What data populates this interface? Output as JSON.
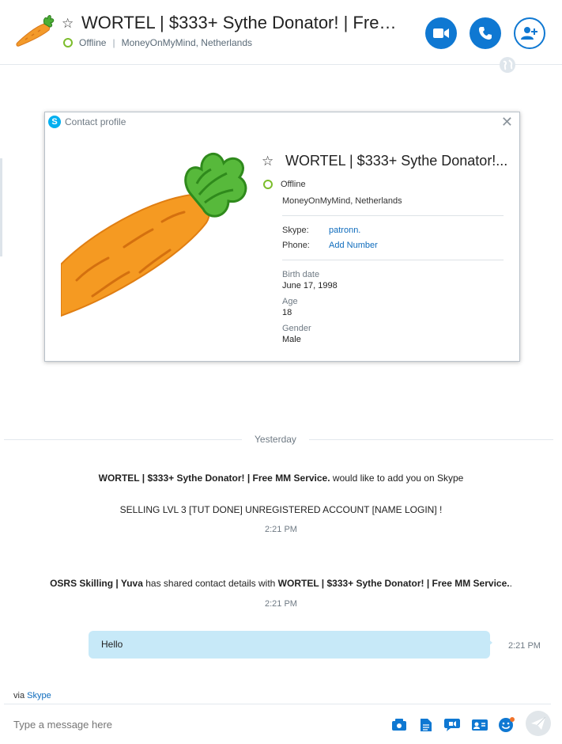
{
  "header": {
    "title": "WORTEL | $333+ Sythe Donator! | Free M...",
    "status": "Offline",
    "location": "MoneyOnMyMind, Netherlands",
    "separator": "|",
    "star_glyph": "☆"
  },
  "profile": {
    "window_title": "Contact profile",
    "skype_glyph": "S",
    "close_glyph": "✕",
    "name": "WORTEL | $333+ Sythe Donator!...",
    "status": "Offline",
    "location": "MoneyOnMyMind, Netherlands",
    "skype_label": "Skype:",
    "skype_value": "patronn.",
    "phone_label": "Phone:",
    "phone_value": "Add Number",
    "birth_label": "Birth date",
    "birth_value": "June 17, 1998",
    "age_label": "Age",
    "age_value": "18",
    "gender_label": "Gender",
    "gender_value": "Male"
  },
  "conversation": {
    "day_label": "Yesterday",
    "messages": [
      {
        "sender": "WORTEL | $333+ Sythe Donator! | Free MM Service.",
        "text": " would like to add you on Skype"
      },
      {
        "text": "SELLING LVL 3 [TUT DONE] UNREGISTERED ACCOUNT [NAME LOGIN] !"
      },
      {
        "time": "2:21 PM"
      },
      {
        "sender": "OSRS Skilling | Yuva",
        "text": " has shared contact details with ",
        "target": "WORTEL | $333+ Sythe Donator! | Free MM Service.",
        "suffix": "."
      },
      {
        "time": "2:21 PM"
      },
      {
        "text": "Hello",
        "time": "2:21 PM"
      }
    ]
  },
  "composer": {
    "via_prefix": "via ",
    "via_link": "Skype",
    "placeholder": "Type a message here"
  },
  "colors": {
    "accent": "#0f78d2",
    "online_ring": "#7cbd2c",
    "bubble": "#c7e9f8"
  },
  "icons": [
    "carrot-avatar-icon",
    "star-icon",
    "video-call-icon",
    "phone-call-icon",
    "add-contact-icon",
    "globe-icon",
    "skype-logo-icon",
    "close-icon",
    "media-icon",
    "file-icon",
    "video-message-icon",
    "contact-card-icon",
    "emoticon-icon",
    "send-icon"
  ]
}
